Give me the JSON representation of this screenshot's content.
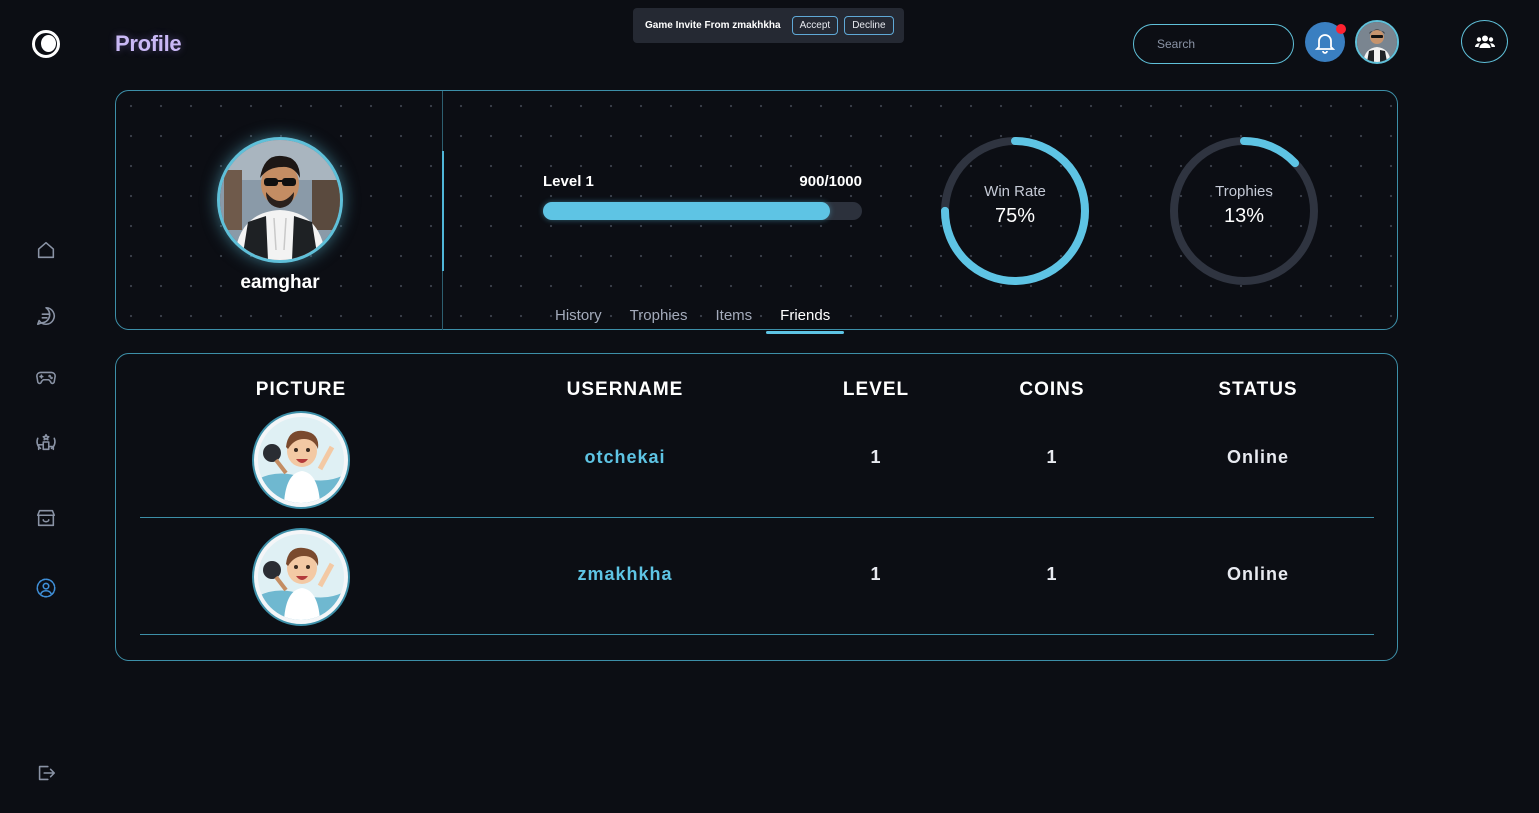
{
  "header": {
    "title": "Profile",
    "search_placeholder": "Search",
    "icons": {
      "logo": "app-logo",
      "bell": "bell-icon",
      "friends": "users-icon"
    }
  },
  "invite": {
    "text": "Game Invite From zmakhkha",
    "accept_label": "Accept",
    "decline_label": "Decline"
  },
  "sidebar": {
    "items": [
      {
        "icon": "home-icon",
        "active": false
      },
      {
        "icon": "chat-icon",
        "active": false
      },
      {
        "icon": "gamepad-icon",
        "active": false
      },
      {
        "icon": "leaderboard-icon",
        "active": false
      },
      {
        "icon": "store-icon",
        "active": false
      },
      {
        "icon": "profile-icon",
        "active": true
      }
    ],
    "logout_icon": "logout-icon"
  },
  "profile": {
    "username": "eamghar",
    "level_label": "Level 1",
    "xp_text": "900/1000",
    "xp_fraction": 0.9,
    "win_rate": {
      "label": "Win Rate",
      "value": "75%",
      "fraction": 0.75
    },
    "trophies": {
      "label": "Trophies",
      "value": "13%",
      "fraction": 0.13
    },
    "tabs": [
      "History",
      "Trophies",
      "Items",
      "Friends"
    ],
    "active_tab": "Friends"
  },
  "friends_table": {
    "columns": [
      "PICTURE",
      "USERNAME",
      "LEVEL",
      "COINS",
      "STATUS"
    ],
    "rows": [
      {
        "username": "otchekai",
        "level": "1",
        "coins": "1",
        "status": "Online"
      },
      {
        "username": "zmakhkha",
        "level": "1",
        "coins": "1",
        "status": "Online"
      }
    ]
  },
  "colors": {
    "accent": "#5ec4e4",
    "border": "#3d8fa8",
    "background": "#0c0e14",
    "notification_dot": "#ff2230",
    "title": "#c9b8f5"
  }
}
